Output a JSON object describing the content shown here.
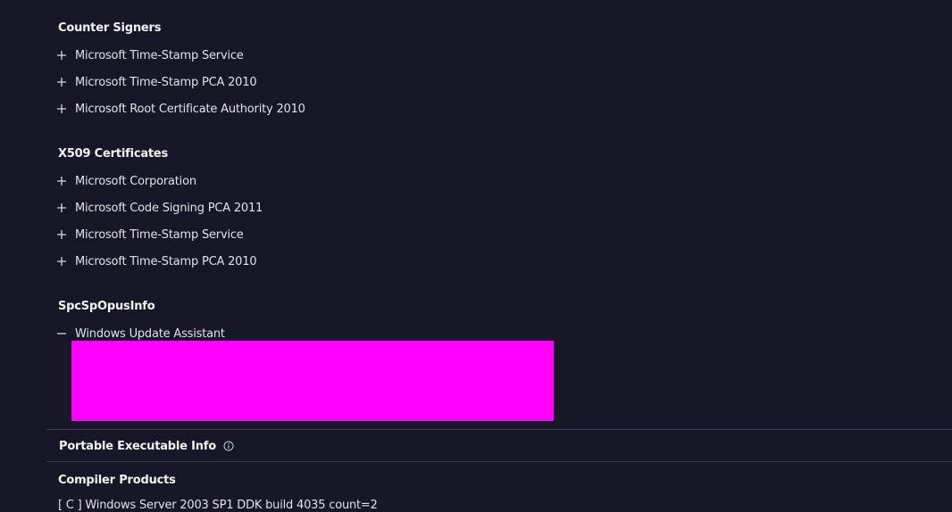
{
  "counter_signers": {
    "title": "Counter Signers",
    "items": [
      {
        "label": "Microsoft Time-Stamp Service",
        "expanded": false
      },
      {
        "label": "Microsoft Time-Stamp PCA 2010",
        "expanded": false
      },
      {
        "label": "Microsoft Root Certificate Authority 2010",
        "expanded": false
      }
    ]
  },
  "x509_certificates": {
    "title": "X509 Certificates",
    "items": [
      {
        "label": "Microsoft Corporation",
        "expanded": false
      },
      {
        "label": "Microsoft Code Signing PCA 2011",
        "expanded": false
      },
      {
        "label": "Microsoft Time-Stamp Service",
        "expanded": false
      },
      {
        "label": "Microsoft Time-Stamp PCA 2010",
        "expanded": false
      }
    ]
  },
  "spc_sp_opus_info": {
    "title": "SpcSpOpusInfo",
    "items": [
      {
        "label": "Windows Update Assistant",
        "expanded": true
      }
    ]
  },
  "portable_executable_info": {
    "title": "Portable Executable Info",
    "icon": "info-icon"
  },
  "compiler_products": {
    "title": "Compiler Products",
    "items": [
      "[ C ] Windows Server 2003 SP1 DDK build 4035 count=2"
    ]
  },
  "colors": {
    "background": "#161626",
    "redaction": "#ff00ff",
    "divider": "#3a3a55"
  }
}
